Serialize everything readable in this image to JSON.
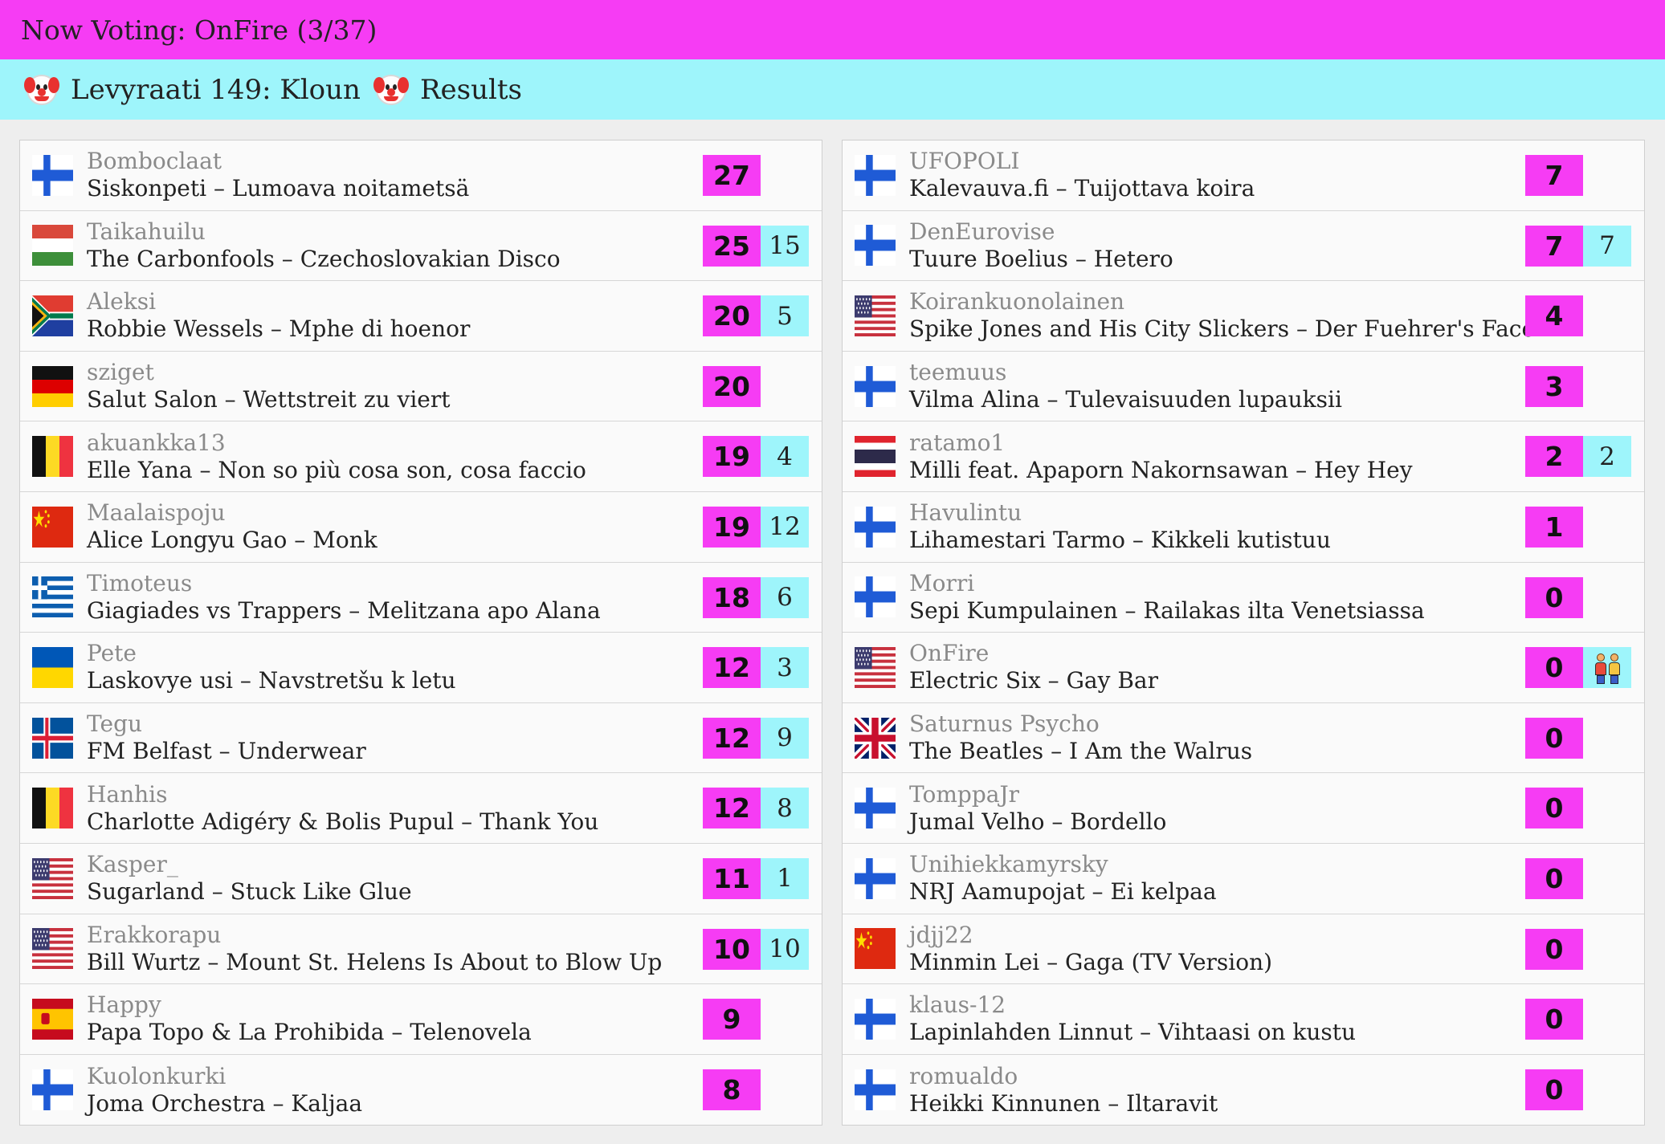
{
  "header": {
    "title": "Now Voting: OnFire (3/37)"
  },
  "subheader": {
    "title": "Levyraati 149: Kloun",
    "results": "Results"
  },
  "columns": [
    [
      {
        "flag": "fi",
        "voter": "Bomboclaat",
        "artist": "Siskonpeti",
        "song": "Lumoava noitametsä",
        "points": "27",
        "given": ""
      },
      {
        "flag": "hu",
        "voter": "Taikahuilu",
        "artist": "The Carbonfools",
        "song": "Czechoslovakian Disco",
        "points": "25",
        "given": "15"
      },
      {
        "flag": "za",
        "voter": "Aleksi",
        "artist": "Robbie Wessels",
        "song": "Mphe di hoenor",
        "points": "20",
        "given": "5"
      },
      {
        "flag": "de",
        "voter": "sziget",
        "artist": "Salut Salon",
        "song": "Wettstreit zu viert",
        "points": "20",
        "given": ""
      },
      {
        "flag": "be",
        "voter": "akuankka13",
        "artist": "Elle Yana",
        "song": "Non so più cosa son, cosa faccio",
        "points": "19",
        "given": "4"
      },
      {
        "flag": "cn",
        "voter": "Maalaispoju",
        "artist": "Alice Longyu Gao",
        "song": "Monk",
        "points": "19",
        "given": "12"
      },
      {
        "flag": "gr",
        "voter": "Timoteus",
        "artist": "Giagiades vs Trappers",
        "song": "Melitzana apo Alana",
        "points": "18",
        "given": "6"
      },
      {
        "flag": "ua",
        "voter": "Pete",
        "artist": "Laskovye usi",
        "song": "Navstretšu k letu",
        "points": "12",
        "given": "3"
      },
      {
        "flag": "is",
        "voter": "Tegu",
        "artist": "FM Belfast",
        "song": "Underwear",
        "points": "12",
        "given": "9"
      },
      {
        "flag": "be",
        "voter": "Hanhis",
        "artist": "Charlotte Adigéry & Bolis Pupul",
        "song": "Thank You",
        "points": "12",
        "given": "8"
      },
      {
        "flag": "us",
        "voter": "Kasper_",
        "artist": "Sugarland",
        "song": "Stuck Like Glue",
        "points": "11",
        "given": "1"
      },
      {
        "flag": "us",
        "voter": "Erakkorapu",
        "artist": "Bill Wurtz",
        "song": "Mount St. Helens Is About to Blow Up",
        "points": "10",
        "given": "10"
      },
      {
        "flag": "es",
        "voter": "Happy",
        "artist": "Papa Topo & La Prohibida",
        "song": "Telenovela",
        "points": "9",
        "given": ""
      },
      {
        "flag": "fi",
        "voter": "Kuolonkurki",
        "artist": "Joma Orchestra",
        "song": "Kaljaa",
        "points": "8",
        "given": ""
      }
    ],
    [
      {
        "flag": "fi",
        "voter": "UFOPOLI",
        "artist": "Kalevauva.fi",
        "song": "Tuijottava koira",
        "points": "7",
        "given": ""
      },
      {
        "flag": "fi",
        "voter": "DenEurovise",
        "artist": "Tuure Boelius",
        "song": "Hetero",
        "points": "7",
        "given": "7"
      },
      {
        "flag": "us",
        "voter": "Koirankuonolainen",
        "artist": "Spike Jones and His City Slickers",
        "song": "Der Fuehrer's Face",
        "points": "4",
        "given": ""
      },
      {
        "flag": "fi",
        "voter": "teemuus",
        "artist": "Vilma Alina",
        "song": "Tulevaisuuden lupauksii",
        "points": "3",
        "given": ""
      },
      {
        "flag": "th",
        "voter": "ratamo1",
        "artist": "Milli feat. Apaporn Nakornsawan",
        "song": "Hey Hey",
        "points": "2",
        "given": "2"
      },
      {
        "flag": "fi",
        "voter": "Havulintu",
        "artist": "Lihamestari Tarmo",
        "song": "Kikkeli kutistuu",
        "points": "1",
        "given": ""
      },
      {
        "flag": "fi",
        "voter": "Morri",
        "artist": "Sepi Kumpulainen",
        "song": "Railakas ilta Venetsiassa",
        "points": "0",
        "given": ""
      },
      {
        "flag": "us",
        "voter": "OnFire",
        "artist": "Electric Six",
        "song": "Gay Bar",
        "points": "0",
        "given": "",
        "current": true
      },
      {
        "flag": "gb",
        "voter": "Saturnus Psycho",
        "artist": "The Beatles",
        "song": "I Am the Walrus",
        "points": "0",
        "given": ""
      },
      {
        "flag": "fi",
        "voter": "TomppaJr",
        "artist": "Jumal Velho",
        "song": "Bordello",
        "points": "0",
        "given": ""
      },
      {
        "flag": "fi",
        "voter": "Unihiekkamyrsky",
        "artist": "NRJ Aamupojat",
        "song": "Ei kelpaa",
        "points": "0",
        "given": ""
      },
      {
        "flag": "cn",
        "voter": "jdjj22",
        "artist": "Minmin Lei",
        "song": "Gaga (TV Version)",
        "points": "0",
        "given": ""
      },
      {
        "flag": "fi",
        "voter": "klaus-12",
        "artist": "Lapinlahden Linnut",
        "song": "Vihtaasi on kustu",
        "points": "0",
        "given": ""
      },
      {
        "flag": "fi",
        "voter": "romualdo",
        "artist": "Heikki Kinnunen",
        "song": "Iltaravit",
        "points": "0",
        "given": ""
      }
    ]
  ],
  "separator": " – ",
  "colors": {
    "points": "#f63cf4",
    "given": "#9ef5fb",
    "header": "#f63cf4",
    "subheader": "#9ef5fb"
  }
}
